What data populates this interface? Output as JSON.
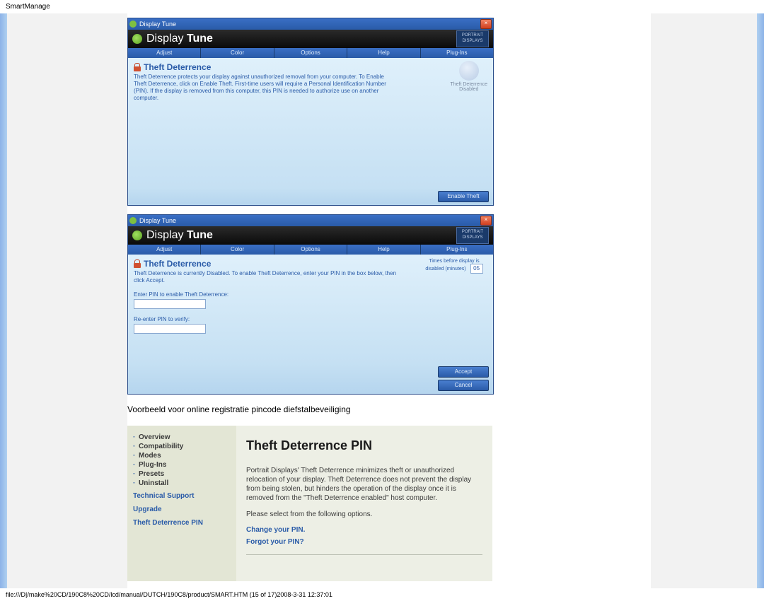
{
  "header": "SmartManage",
  "win1": {
    "title": "Display Tune",
    "appName": "Display",
    "appNameBold": "Tune",
    "brand": "PORTRAIT DISPLAYS",
    "tabs": [
      "Adjust",
      "Color",
      "Options",
      "Help",
      "Plug-Ins"
    ],
    "panelTitle": "Theft Deterrence",
    "desc": "Theft Deterrence protects your display against unauthorized removal from your computer. To Enable Theft Deterrence, click on Enable Theft. First-time users will require a Personal Identification Number (PIN). If the display is removed from this computer, this PIN is needed to authorize use on another computer.",
    "statusLabel": "Theft Deterrence",
    "statusValue": "Disabled",
    "btn": "Enable Theft"
  },
  "win2": {
    "title": "Display Tune",
    "appName": "Display",
    "appNameBold": "Tune",
    "brand": "PORTRAIT DISPLAYS",
    "tabs": [
      "Adjust",
      "Color",
      "Options",
      "Help",
      "Plug-Ins"
    ],
    "panelTitle": "Theft Deterrence",
    "desc": "Theft Deterrence is currently Disabled. To enable Theft Deterrence, enter your PIN in the box below, then click Accept.",
    "statusLabel": "Times before display is disabled (minutes)",
    "statusNum": "05",
    "pinLabel": "Enter PIN to enable Theft Deterrence:",
    "reenterLabel": "Re-enter PIN to verify:",
    "btnAccept": "Accept",
    "btnCancel": "Cancel"
  },
  "caption": "Voorbeeld voor online registratie pincode diefstalbeveiliging",
  "help": {
    "nav": {
      "items": [
        "Overview",
        "Compatibility",
        "Modes",
        "Plug-Ins",
        "Presets",
        "Uninstall"
      ],
      "h1": "Technical Support",
      "h2": "Upgrade",
      "h3": "Theft Deterrence PIN"
    },
    "title": "Theft Deterrence PIN",
    "p1": "Portrait Displays' Theft Deterrence minimizes theft or unauthorized relocation of your display. Theft Deterrence does not prevent the display from being stolen, but hinders the operation of the display once it is removed from the \"Theft Deterrence enabled\" host computer.",
    "p2": "Please select from the following options.",
    "link1": "Change your PIN.",
    "link2": "Forgot your PIN?"
  },
  "footer": "file:///D|/make%20CD/190C8%20CD/lcd/manual/DUTCH/190C8/product/SMART.HTM (15 of 17)2008-3-31 12:37:01"
}
